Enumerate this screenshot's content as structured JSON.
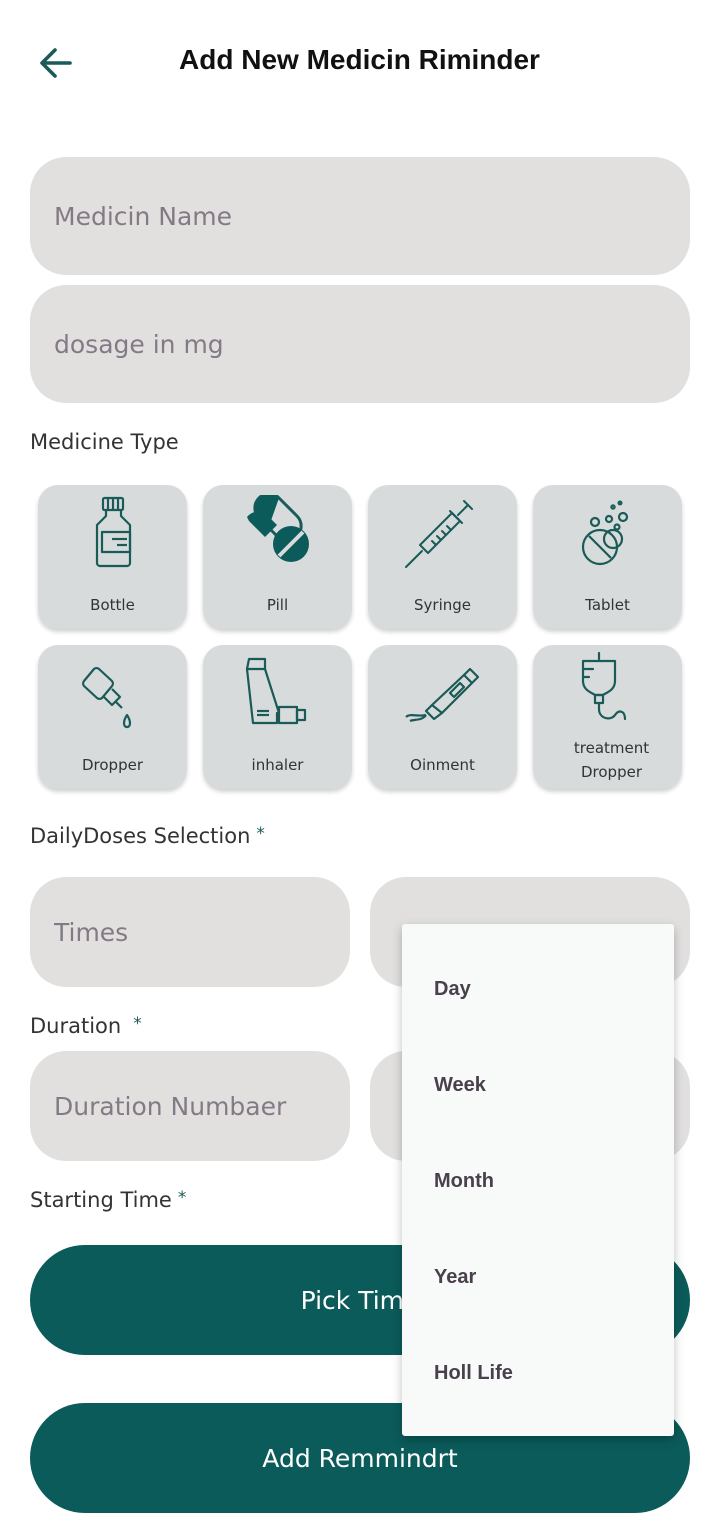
{
  "header": {
    "title": "Add New Medicin Riminder",
    "back_icon": "arrow-left-icon"
  },
  "form": {
    "medicine_name_placeholder": "Medicin Name",
    "dosage_placeholder": "dosage in mg",
    "medicine_type_label": "Medicine Type",
    "medicine_types": [
      {
        "label": "Bottle",
        "icon": "bottle-icon"
      },
      {
        "label": "Pill",
        "icon": "pill-icon"
      },
      {
        "label": "Syringe",
        "icon": "syringe-icon"
      },
      {
        "label": "Tablet",
        "icon": "tablet-icon"
      },
      {
        "label": "Dropper",
        "icon": "dropper-icon"
      },
      {
        "label": "inhaler",
        "icon": "inhaler-icon"
      },
      {
        "label": "Oinment",
        "icon": "ointment-icon"
      },
      {
        "label": "treatment Dropper",
        "icon": "iv-drip-icon"
      }
    ],
    "daily_doses_label": "DailyDoses Selection",
    "required_mark": "*",
    "times_placeholder": "Times",
    "duration_label": "Duration",
    "duration_placeholder": "Duration Numbaer",
    "starting_time_label": "Starting Time",
    "pick_time_label": "Pick Time",
    "add_reminder_label": "Add Remmindrt"
  },
  "dropdown": {
    "options": [
      "Day",
      "Week",
      "Month",
      "Year",
      "Holl Life"
    ]
  },
  "colors": {
    "accent": "#0b5b5a",
    "field_bg": "#e1e0df",
    "card_bg": "#d7dbdc",
    "icon": "#1a5a57"
  }
}
